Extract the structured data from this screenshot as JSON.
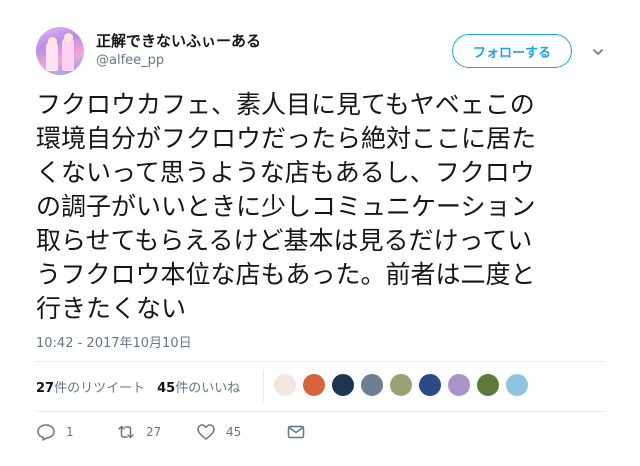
{
  "author": {
    "display_name": "正解できないふぃーある",
    "handle": "@alfee_pp"
  },
  "follow_button": {
    "label": "フォローする"
  },
  "tweet": {
    "text": "フクロウカフェ、素人目に見てもヤベェこの\n環境自分がフクロウだったら絶対ここに居た\nくないって思うような店もあるし、フクロウ\nの調子がいいときに少しコミュニケーション\n取らせてもらえるけど基本は見るだけってい\nうフクロウ本位な店もあった。前者は二度と\n行きたくない",
    "timestamp": "10:42 - 2017年10月10日"
  },
  "stats": {
    "retweets_count": "27",
    "retweets_label": "件のリツイート",
    "likes_count": "45",
    "likes_label": "件のいいね"
  },
  "liker_avatars": [
    {
      "name": "liker-avatar-1",
      "color": "#f2e6e0"
    },
    {
      "name": "liker-avatar-2",
      "color": "#d9633a"
    },
    {
      "name": "liker-avatar-3",
      "color": "#1e3550"
    },
    {
      "name": "liker-avatar-4",
      "color": "#6d7f91"
    },
    {
      "name": "liker-avatar-5",
      "color": "#9aa07a"
    },
    {
      "name": "liker-avatar-6",
      "color": "#2b4a8c"
    },
    {
      "name": "liker-avatar-7",
      "color": "#a993c8"
    },
    {
      "name": "liker-avatar-8",
      "color": "#5d7a3a"
    },
    {
      "name": "liker-avatar-9",
      "color": "#8fc4e0"
    }
  ],
  "actions": {
    "reply_count": "1",
    "retweet_count": "27",
    "like_count": "45"
  },
  "colors": {
    "accent": "#1da1f2",
    "text": "#14171a",
    "muted": "#657786",
    "divider": "#e6ecf0"
  },
  "icons": [
    "chevron-down-icon",
    "reply-icon",
    "retweet-icon",
    "like-icon",
    "message-icon"
  ]
}
